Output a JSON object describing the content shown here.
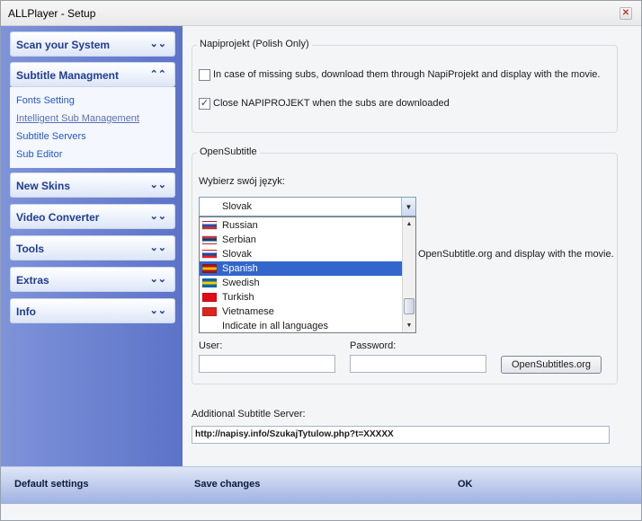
{
  "window": {
    "title": "ALLPlayer - Setup",
    "close_glyph": "✕"
  },
  "sidebar": {
    "sections": [
      {
        "label": "Scan your System",
        "chevron": "⌄⌄"
      },
      {
        "label": "Subtitle Managment",
        "chevron": "⌃⌃"
      },
      {
        "label": "New Skins",
        "chevron": "⌄⌄"
      },
      {
        "label": "Video Converter",
        "chevron": "⌄⌄"
      },
      {
        "label": "Tools",
        "chevron": "⌄⌄"
      },
      {
        "label": "Extras",
        "chevron": "⌄⌄"
      },
      {
        "label": "Info",
        "chevron": "⌄⌄"
      }
    ],
    "subtitle_items": [
      {
        "label": "Fonts Setting"
      },
      {
        "label": "Intelligent Sub Management"
      },
      {
        "label": "Subtitle Servers"
      },
      {
        "label": "Sub Editor"
      }
    ]
  },
  "napiprojekt": {
    "title": "Napiprojekt (Polish Only)",
    "option1": {
      "label": "In case of missing subs, download them through NapiProjekt and display with the movie.",
      "checked": false
    },
    "option2": {
      "label": "Close NAPIPROJEKT when the subs are downloaded",
      "checked": true,
      "check_glyph": "✓"
    }
  },
  "opensubtitle": {
    "title": "OpenSubtitle",
    "language_label": "Wybierz swój język:",
    "selected_language": "Slovak",
    "hidden_option_text": "OpenSubtitle.org and display with the movie.",
    "languages": [
      {
        "label": "Russian",
        "flag_colors": [
          "#ffffff",
          "#2c4ea5",
          "#d32b2b"
        ]
      },
      {
        "label": "Serbian",
        "flag_colors": [
          "#c6363c",
          "#0c4076",
          "#ffffff"
        ]
      },
      {
        "label": "Slovak",
        "flag_colors": [
          "#ffffff",
          "#0b4ea2",
          "#ee1c25"
        ]
      },
      {
        "label": "Spanish",
        "flag_colors": [
          "#aa151b",
          "#f1bf00",
          "#aa151b"
        ]
      },
      {
        "label": "Swedish",
        "flag_colors": [
          "#006aa7",
          "#fecc00",
          "#006aa7"
        ]
      },
      {
        "label": "Turkish",
        "flag_colors": [
          "#e30a17",
          "#e30a17",
          "#e30a17"
        ]
      },
      {
        "label": "Vietnamese",
        "flag_colors": [
          "#da251d",
          "#da251d",
          "#da251d"
        ]
      },
      {
        "label": "Indicate in all languages",
        "flag_colors": []
      }
    ],
    "selected_index": 3,
    "user_label": "User:",
    "password_label": "Password:",
    "user_value": "",
    "password_value": "",
    "site_button": "OpenSubtitles.org"
  },
  "additional_server": {
    "label": "Additional Subtitle Server:",
    "value": "http://napisy.info/SzukajTytulow.php?t=XXXXX"
  },
  "footer": {
    "default_settings": "Default settings",
    "save_changes": "Save changes",
    "ok": "OK"
  }
}
